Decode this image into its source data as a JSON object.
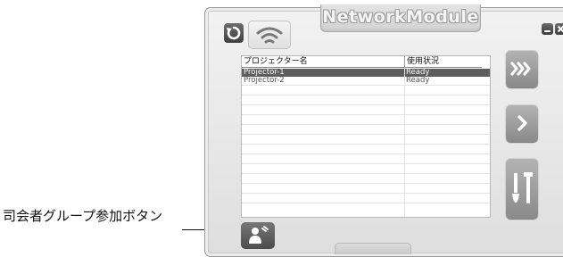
{
  "annotation": {
    "label": "司会者グループ参加ボタン"
  },
  "window": {
    "title": "NetworkModule"
  },
  "table": {
    "columns": [
      "プロジェクター名",
      "使用状況"
    ],
    "rows": [
      {
        "name": "Projector-1",
        "status": "Ready",
        "selected": true
      },
      {
        "name": "Projector-2",
        "status": "Ready",
        "selected": false
      }
    ]
  },
  "icons": {
    "refresh": "refresh-icon",
    "wifi": "wifi-icon",
    "fast_forward": "fast-forward-icon",
    "next": "chevron-right-icon",
    "tools": "tools-icon",
    "host": "presenter-icon",
    "minimize": "minimize-icon",
    "close": "close-icon"
  },
  "colors": {
    "button_gray": "#9e9e9e",
    "selected_row": "#5d5d5d"
  }
}
